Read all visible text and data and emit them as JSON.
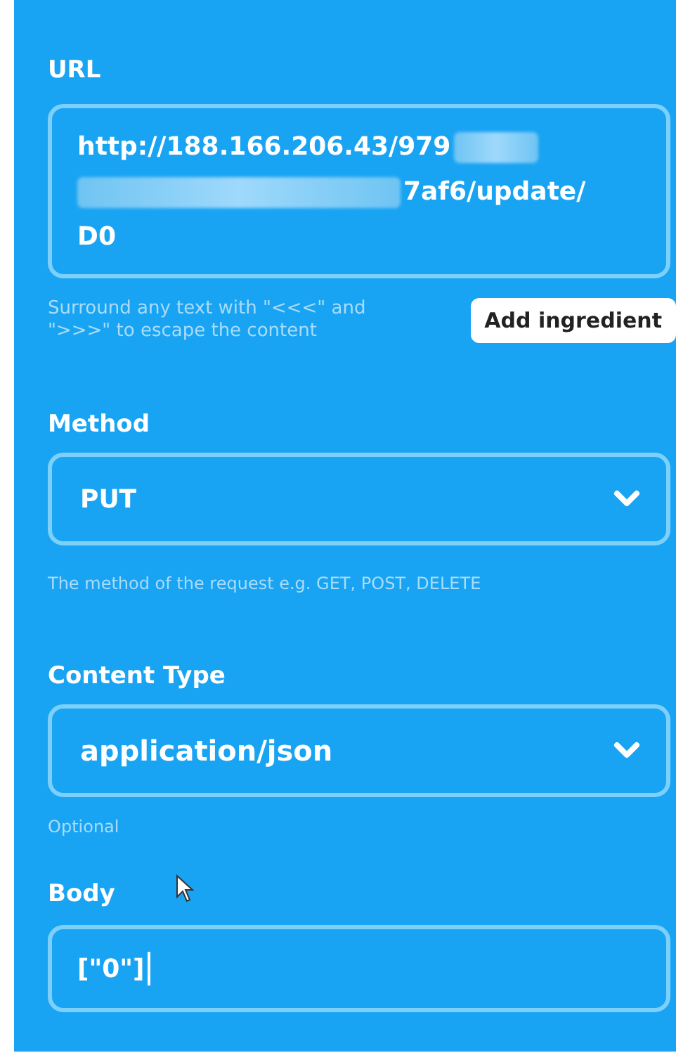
{
  "url": {
    "label": "URL",
    "lines": [
      {
        "text": "http://188.166.206.43/979",
        "blur_before": false,
        "blur_after": true
      },
      {
        "text": "7af6/update/",
        "blur_before": true,
        "blur_after": false
      },
      {
        "text": "D0",
        "blur_before": false,
        "blur_after": false
      }
    ],
    "help": "Surround any text with \"<<<\" and \">>>\" to escape the content",
    "button": "Add ingredient"
  },
  "method": {
    "label": "Method",
    "value": "PUT",
    "help": "The method of the request e.g. GET, POST, DELETE"
  },
  "content_type": {
    "label": "Content Type",
    "value": "application/json",
    "help": "Optional"
  },
  "body": {
    "label": "Body",
    "value": "[\"0\"]",
    "focused": true
  }
}
